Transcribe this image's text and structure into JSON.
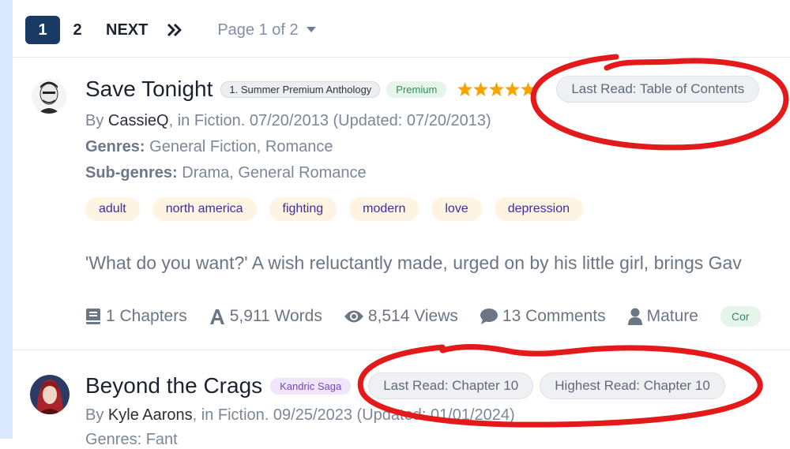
{
  "pagination": {
    "pages": [
      "1",
      "2"
    ],
    "active": "1",
    "next_label": "NEXT",
    "page_select": "Page 1 of 2"
  },
  "stories": [
    {
      "title": "Save Tonight",
      "series_badge": "1. Summer Premium Anthology",
      "premium_badge": "Premium",
      "stars": 5,
      "last_read": "Last Read: Table of Contents",
      "byline": {
        "prefix": "By ",
        "author": "CassieQ",
        "rest": ", in Fiction. 07/20/2013 (Updated: 07/20/2013)"
      },
      "genres_label": "Genres:",
      "genres": "General Fiction, Romance",
      "subgenres_label": "Sub-genres:",
      "subgenres": "Drama, General Romance",
      "tags": [
        "adult",
        "north america",
        "fighting",
        "modern",
        "love",
        "depression"
      ],
      "description": "'What do you want?' A wish reluctantly made, urged on by his little girl, brings Gav",
      "stats": {
        "chapters": "1 Chapters",
        "words": "5,911 Words",
        "views": "8,514 Views",
        "comments": "13 Comments",
        "rating": "Mature",
        "completion": "Cor"
      }
    },
    {
      "title": "Beyond the Crags",
      "series_badge": "Kandric Saga",
      "last_read": "Last Read: Chapter 10",
      "highest_read": "Highest Read: Chapter 10",
      "byline": {
        "prefix": "By ",
        "author": "Kyle Aarons",
        "rest": ", in Fiction. 09/25/2023 (Updated: 01/01/2024)"
      },
      "genres_partial": "Genres: Fant"
    }
  ],
  "colors": {
    "accent": "#193b63",
    "annotation": "#e41a1a",
    "star": "#f5a400",
    "tag_bg": "#fff3e2"
  },
  "icons": [
    "chevrons-right-icon",
    "caret-down-icon",
    "book-icon",
    "font-icon",
    "eye-icon",
    "comment-icon",
    "user-icon",
    "star-icon"
  ]
}
